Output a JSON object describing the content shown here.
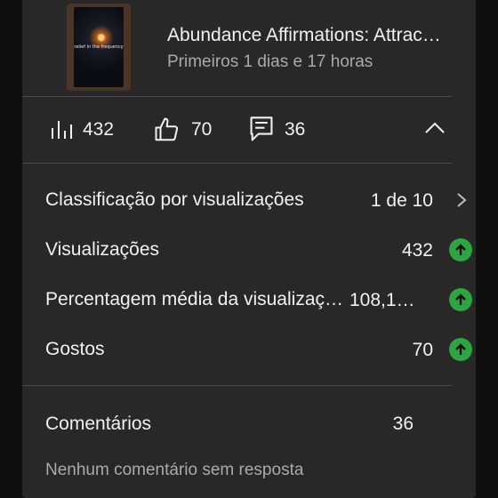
{
  "video": {
    "thumbnail_caption": "relief in the frequency",
    "title": "Abundance Affirmations: Attrac…",
    "period": "Primeiros 1 dias e 17 horas"
  },
  "stats": {
    "views": "432",
    "likes": "70",
    "comments": "36"
  },
  "metrics": [
    {
      "label": "Classificação por visualizações",
      "value": "1 de 10",
      "indicator": "chevron-right-icon"
    },
    {
      "label": "Visualizações",
      "value": "432",
      "indicator": "arrow-up-icon"
    },
    {
      "label": "Percentagem média da visualizaç…",
      "value": "108,1…",
      "indicator": "arrow-up-icon"
    },
    {
      "label": "Gostos",
      "value": "70",
      "indicator": "arrow-up-icon"
    }
  ],
  "comments_section": {
    "label": "Comentários",
    "count": "36",
    "no_reply_text": "Nenhum comentário sem resposta"
  },
  "colors": {
    "background": "#0f0f0f",
    "card": "#282828",
    "positive": "#2ba640",
    "secondary_text": "#aaaaaa"
  }
}
